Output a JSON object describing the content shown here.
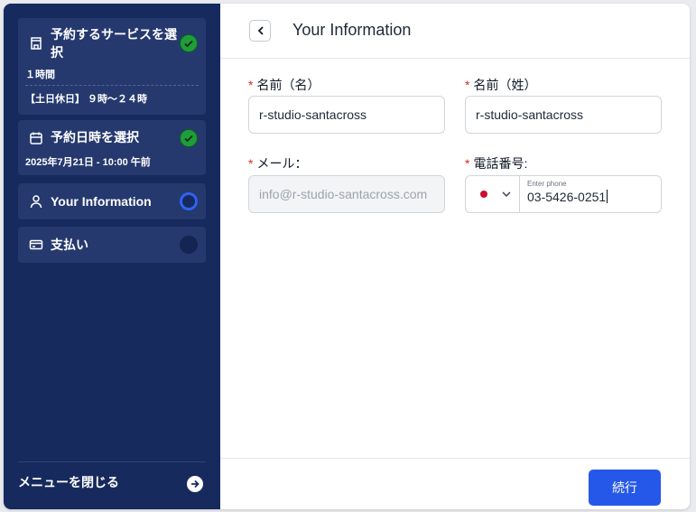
{
  "sidebar": {
    "steps": [
      {
        "title": "予約するサービスを選択",
        "duration": "１時間",
        "hours": "【土日休日】 ９時〜２４時",
        "status": "done",
        "icon": "store-icon"
      },
      {
        "title": "予約日時を選択",
        "datetime": "2025年7月21日 - 10:00 午前",
        "status": "done",
        "icon": "calendar-icon"
      },
      {
        "title": "Your Information",
        "status": "current",
        "icon": "user-icon"
      },
      {
        "title": "支払い",
        "status": "pending",
        "icon": "credit-card-icon"
      }
    ],
    "close_label": "メニューを閉じる"
  },
  "header": {
    "title": "Your Information"
  },
  "form": {
    "first_name": {
      "label": "名前（名）",
      "value": "r-studio-santacross"
    },
    "last_name": {
      "label": "名前（姓）",
      "value": "r-studio-santacross"
    },
    "email": {
      "label": "メール：",
      "value": "info@r-studio-santacross.com"
    },
    "phone": {
      "label": "電話番号:",
      "hint": "Enter phone",
      "value": "03-5426-0251"
    },
    "required_mark": "*"
  },
  "footer": {
    "continue_label": "続行"
  },
  "colors": {
    "sidebar": "#172a5e",
    "step_card": "#25396e",
    "done": "#1f9d3a",
    "current": "#2f62f0",
    "primary": "#2558e8",
    "required": "#d92d20"
  }
}
